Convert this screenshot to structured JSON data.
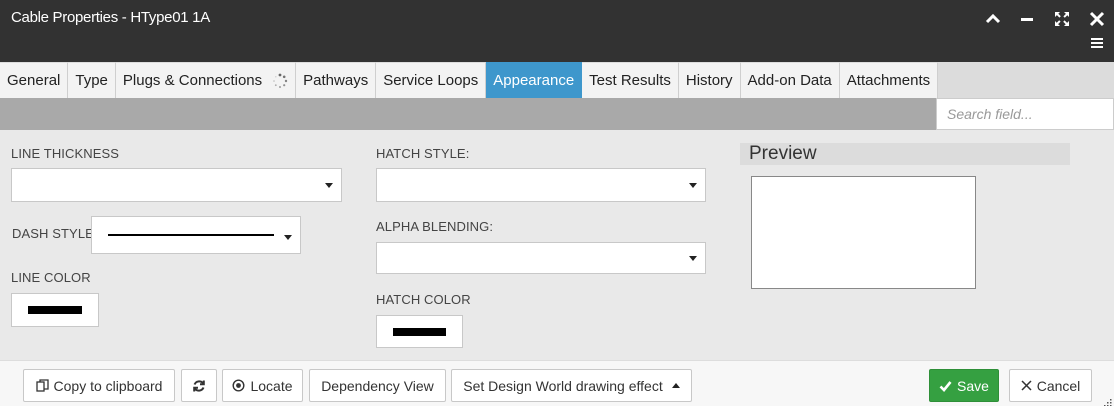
{
  "window": {
    "title": "Cable Properties - HType01 1A",
    "controls": [
      "chevron-up-icon",
      "minimize-icon",
      "expand-icon",
      "close-icon",
      "menu-icon"
    ]
  },
  "tabs": [
    {
      "label": "General",
      "active": false
    },
    {
      "label": "Type",
      "active": false
    },
    {
      "label": "Plugs & Connections",
      "active": false,
      "loading": true
    },
    {
      "label": "Pathways",
      "active": false
    },
    {
      "label": "Service Loops",
      "active": false
    },
    {
      "label": "Appearance",
      "active": true
    },
    {
      "label": "Test Results",
      "active": false
    },
    {
      "label": "History",
      "active": false
    },
    {
      "label": "Add-on Data",
      "active": false
    },
    {
      "label": "Attachments",
      "active": false
    }
  ],
  "search": {
    "placeholder": "Search field...",
    "value": ""
  },
  "form": {
    "line_thickness_label": "LINE THICKNESS",
    "line_thickness_value": "",
    "dash_style_label": "DASH STYLE",
    "line_color_label": "LINE COLOR",
    "line_color": "#000000",
    "hatch_style_label": "HATCH STYLE:",
    "hatch_style_value": "",
    "alpha_blending_label": "ALPHA BLENDING:",
    "alpha_blending_value": "",
    "hatch_color_label": "HATCH COLOR",
    "hatch_color": "#000000"
  },
  "preview": {
    "title": "Preview"
  },
  "footer": {
    "copy_label": "Copy to clipboard",
    "locate_label": "Locate",
    "dependency_label": "Dependency View",
    "drawing_effect_label": "Set Design World drawing effect",
    "save_label": "Save",
    "cancel_label": "Cancel"
  },
  "colors": {
    "titlebar": "#323232",
    "active_tab": "#3e97cc",
    "save": "#35a041"
  }
}
